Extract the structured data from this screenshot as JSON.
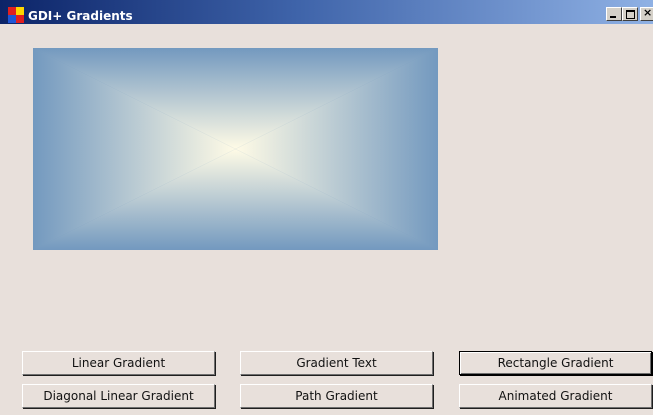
{
  "window": {
    "title": "GDI+ Gradients",
    "controls": {
      "minimize": "_",
      "maximize": "□",
      "close": "x"
    }
  },
  "colors": {
    "gradient_center": "#fffbe6",
    "gradient_edge": "#7399bf",
    "background": "#e8e0db"
  },
  "buttons": {
    "linear_gradient": "Linear Gradient",
    "gradient_text": "Gradient Text",
    "rectangle_gradient": "Rectangle Gradient",
    "diagonal_linear_gradient": "Diagonal Linear Gradient",
    "path_gradient": "Path Gradient",
    "animated_gradient": "Animated Gradient"
  }
}
